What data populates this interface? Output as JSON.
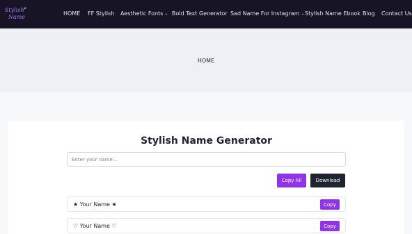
{
  "logo": {
    "line1": "Stylish",
    "line2": "Name",
    "sparkle": "✦"
  },
  "nav": {
    "items": [
      {
        "label": "HOME",
        "caret": ""
      },
      {
        "label": "FF Stylish",
        "caret": ""
      },
      {
        "label": "Aesthetic Fonts",
        "caret": "⌄"
      },
      {
        "label": "Bold Text Generator",
        "caret": ""
      },
      {
        "label": "Sad Name For Instagram",
        "caret": "⌄"
      },
      {
        "label": "Stylish Name Ebook",
        "caret": ""
      },
      {
        "label": "Blog",
        "caret": ""
      },
      {
        "label": "Contact Us",
        "caret": ""
      }
    ]
  },
  "hero": {
    "breadcrumb": "HOME"
  },
  "generator": {
    "title": "Stylish Name Generator",
    "input": {
      "value": "",
      "placeholder": "Enter your name..."
    },
    "copy_all_label": "Copy All",
    "download_label": "Download",
    "results": [
      {
        "text": "★ Your Name ★",
        "copy_label": "Copy"
      },
      {
        "text": "♡ Your Name ♡",
        "copy_label": "Copy"
      }
    ]
  },
  "colors": {
    "navbar_bg": "#171525",
    "accent_purple": "#8f34e6",
    "download_bg": "#1f2530",
    "hero_bg": "#edf0f4"
  }
}
